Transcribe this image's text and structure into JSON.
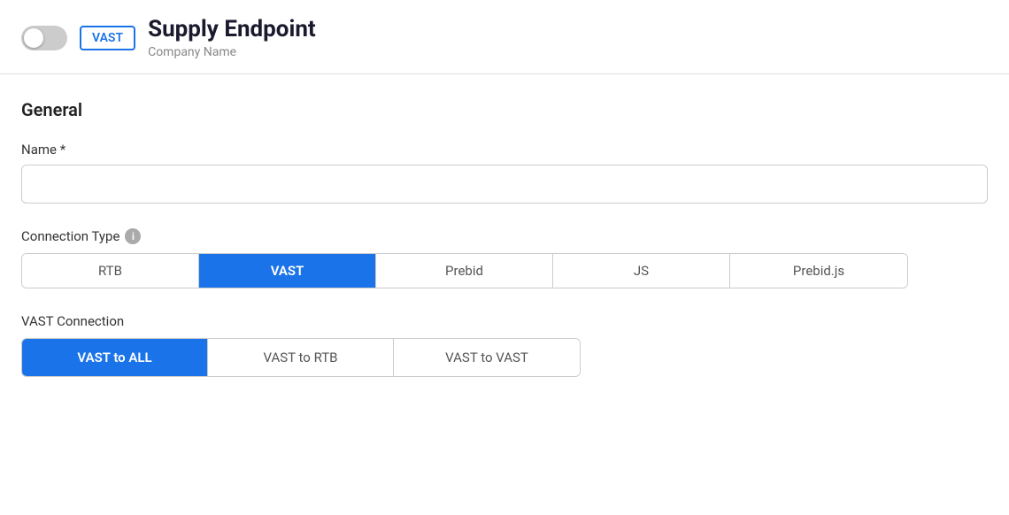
{
  "header": {
    "title": "Supply Endpoint",
    "subtitle": "Company Name",
    "badge_label": "VAST"
  },
  "toggle": {
    "state": "off"
  },
  "sections": {
    "general": {
      "label": "General"
    }
  },
  "name_field": {
    "label": "Name *",
    "placeholder": "",
    "value": ""
  },
  "connection_type": {
    "label": "Connection Type",
    "info_icon_label": "i",
    "options": [
      {
        "id": "rtb",
        "label": "RTB",
        "active": false
      },
      {
        "id": "vast",
        "label": "VAST",
        "active": true
      },
      {
        "id": "prebid",
        "label": "Prebid",
        "active": false
      },
      {
        "id": "js",
        "label": "JS",
        "active": false
      },
      {
        "id": "prebid-js",
        "label": "Prebid.js",
        "active": false
      }
    ]
  },
  "vast_connection": {
    "label": "VAST Connection",
    "options": [
      {
        "id": "vast-to-all",
        "label": "VAST to ALL",
        "active": true
      },
      {
        "id": "vast-to-rtb",
        "label": "VAST to RTB",
        "active": false
      },
      {
        "id": "vast-to-vast",
        "label": "VAST to VAST",
        "active": false
      }
    ]
  }
}
